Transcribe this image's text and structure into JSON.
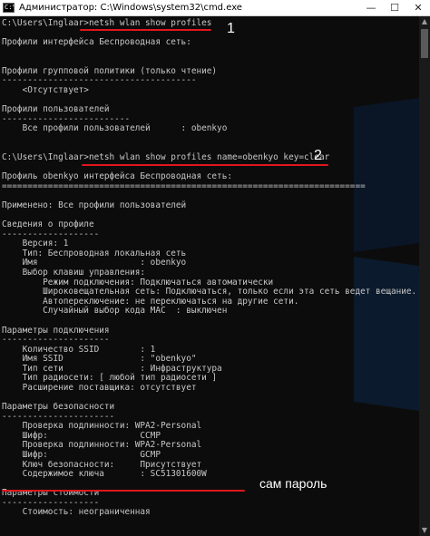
{
  "window": {
    "title": "Администратор: C:\\Windows\\system32\\cmd.exe",
    "minimize": "—",
    "maximize": "☐",
    "close": "✕",
    "icon": "cmd-icon"
  },
  "console": {
    "lines": [
      "C:\\Users\\Inglaar>netsh wlan show profiles",
      "",
      "Профили интерфейса Беспроводная сеть:",
      "",
      "",
      "Профили групповой политики (только чтение)",
      "--------------------------------------",
      "    <Отсутствует>",
      "",
      "Профили пользователей",
      "-------------------------",
      "    Все профили пользователей      : obenkyo",
      "",
      "",
      "C:\\Users\\Inglaar>netsh wlan show profiles name=obenkyo key=clear",
      "",
      "Профиль obenkyo интерфейса Беспроводная сеть:",
      "=======================================================================",
      "",
      "Применено: Все профили пользователей",
      "",
      "Сведения о профиле",
      "-------------------",
      "    Версия: 1",
      "    Тип: Беспроводная локальная сеть",
      "    Имя                    : obenkyo",
      "    Выбор клавиш управления:",
      "        Режим подключения: Подключаться автоматически",
      "        Широковещательная сеть: Подключаться, только если эта сеть ведет вещание.",
      "        Автопереключение: не переключаться на другие сети.",
      "        Случайный выбор кода MAC  : выключен",
      "",
      "Параметры подключения",
      "---------------------",
      "    Количество SSID        : 1",
      "    Имя SSID               : \"obenkyo\"",
      "    Тип сети               : Инфраструктура",
      "    Тип радиосети: [ любой тип радиосети ]",
      "    Расширение поставщика: отсутствует",
      "",
      "Параметры безопасности",
      "----------------------",
      "    Проверка подлинности: WPA2-Personal",
      "    Шифр:                  CCMP",
      "    Проверка подлинности: WPA2-Personal",
      "    Шифр:                  GCMP",
      "    Ключ безопасности:     Присутствует",
      "    Содержимое ключа       : SC51301600W",
      "",
      "Параметры стоимости",
      "-------------------",
      "    Стоимость: неограниченная"
    ]
  },
  "annotations": {
    "step1": "1",
    "step2": "2",
    "password_label": "сам пароль",
    "underline_color": "#e0171d"
  },
  "scrollbar": {
    "up": "▲",
    "down": "▼"
  }
}
